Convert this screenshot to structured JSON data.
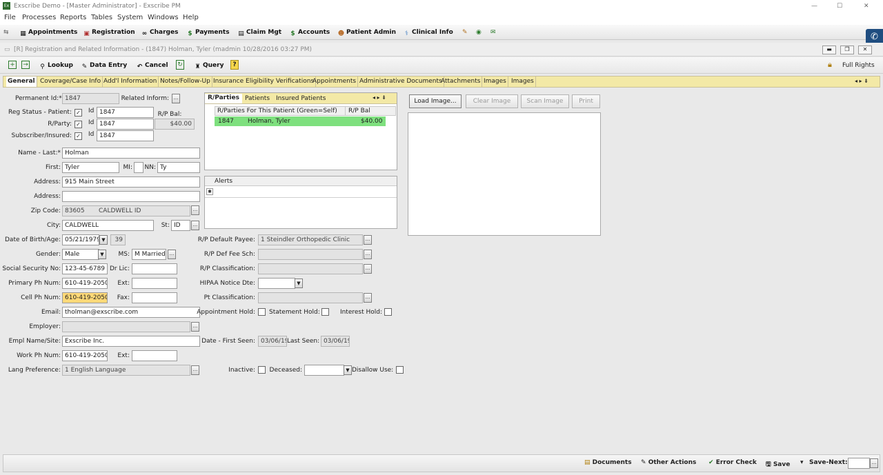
{
  "window": {
    "title": "Exscribe Demo - [Master Administrator] - Exscribe PM",
    "minimize": "—",
    "maximize": "☐",
    "close": "✕"
  },
  "menu": [
    "File",
    "Processes",
    "Reports",
    "Tables",
    "System",
    "Windows",
    "Help"
  ],
  "toolbar": {
    "appointments": "Appointments",
    "registration": "Registration",
    "charges": "Charges",
    "payments": "Payments",
    "claim_mgt": "Claim Mgt",
    "accounts": "Accounts",
    "patient_admin": "Patient Admin",
    "clinical_info": "Clinical Info"
  },
  "subwindow": {
    "title": "[R] Registration and Related Information - (1847) Holman, Tyler (madmin 10/28/2016 03:27 PM)"
  },
  "actions": {
    "lookup": "Lookup",
    "data_entry": "Data Entry",
    "cancel": "Cancel",
    "query": "Query",
    "help": "?",
    "full_rights": "Full Rights"
  },
  "tabs": [
    "General",
    "Coverage/Case Info",
    "Add'l Information",
    "Notes/Follow-Up",
    "Insurance Eligibility Verifications",
    "Appointments",
    "Administrative Documents",
    "Attachments",
    "Images",
    "Images"
  ],
  "form": {
    "permanent_id_label": "Permanent Id:*",
    "permanent_id": "1847",
    "related_inform_label": "Related Inform:",
    "reg_status_label": "Reg Status - Patient:",
    "rparty_label": "R/Party:",
    "subscriber_label": "Subscriber/Insured:",
    "id_label": "Id",
    "patient_id": "1847",
    "rparty_id": "1847",
    "subscriber_id": "1847",
    "rp_bal_label": "R/P Bal:",
    "rp_bal": "$40.00",
    "name_last_label": "Name - Last:*",
    "name_last": "Holman",
    "first_label": "First:",
    "first": "Tyler",
    "mi_label": "MI:",
    "mi": "",
    "nn_label": "NN:",
    "nn": "Ty",
    "address_label": "Address:",
    "address1": "915 Main Street",
    "address2": "",
    "zip_label": "Zip Code:",
    "zip": "83605",
    "zip_city": "CALDWELL ID",
    "city_label": "City:",
    "city": "CALDWELL",
    "st_label": "St:",
    "st": "ID",
    "dob_label": "Date of Birth/Age:",
    "dob": "05/21/1979",
    "age": "39",
    "gender_label": "Gender:",
    "gender": "Male",
    "ms_label": "MS:",
    "ms": "M  Married",
    "ssn_label": "Social Security No:",
    "ssn": "123-45-6789",
    "drlic_label": "Dr Lic:",
    "drlic": "",
    "primary_ph_label": "Primary Ph Num:",
    "primary_ph": "610-419-2050",
    "ext_label": "Ext:",
    "cell_ph_label": "Cell Ph Num:",
    "cell_ph": "610-419-2050",
    "fax_label": "Fax:",
    "email_label": "Email:",
    "email": "tholman@exscribe.com",
    "employer_label": "Employer:",
    "employer": "",
    "empl_name_label": "Empl Name/Site:",
    "empl_name": "Exscribe Inc.",
    "work_ph_label": "Work Ph Num:",
    "work_ph": "610-419-2050",
    "lang_label": "Lang Preference:",
    "lang": "1    English Language"
  },
  "rparties": {
    "tab_rparties": "R/Parties",
    "tab_patients": "Patients",
    "tab_insured": "Insured Patients",
    "col_name": "R/Parties For This Patient (Green=Self)",
    "col_bal": "R/P Bal",
    "rows": [
      {
        "id": "1847",
        "name": "Holman, Tyler",
        "bal": "$40.00"
      }
    ]
  },
  "alerts": {
    "header": "Alerts"
  },
  "right": {
    "default_payee_label": "R/P Default Payee:",
    "default_payee": "1    Steindler Orthopedic Clinic",
    "def_fee_label": "R/P Def Fee Sch:",
    "classification_label": "R/P Classification:",
    "hipaa_label": "HIPAA Notice Dte:",
    "pt_class_label": "Pt Classification:",
    "appt_hold_label": "Appointment Hold:",
    "stmt_hold_label": "Statement Hold:",
    "interest_hold_label": "Interest Hold:",
    "first_seen_label": "Date - First Seen:",
    "first_seen": "03/06/19",
    "last_seen_label": "Last Seen:",
    "last_seen": "03/06/19",
    "inactive_label": "Inactive:",
    "deceased_label": "Deceased:",
    "disallow_label": "Disallow Use:"
  },
  "image": {
    "load": "Load Image...",
    "clear": "Clear Image",
    "scan": "Scan Image",
    "print": "Print"
  },
  "status": {
    "documents": "Documents",
    "other_actions": "Other Actions",
    "error_check": "Error Check",
    "save": "Save",
    "save_next": "Save-Next:"
  },
  "colors": {
    "tab_bar": "#f3e9a6",
    "self_row": "#7ee07e",
    "highlight": "#ffd978"
  }
}
